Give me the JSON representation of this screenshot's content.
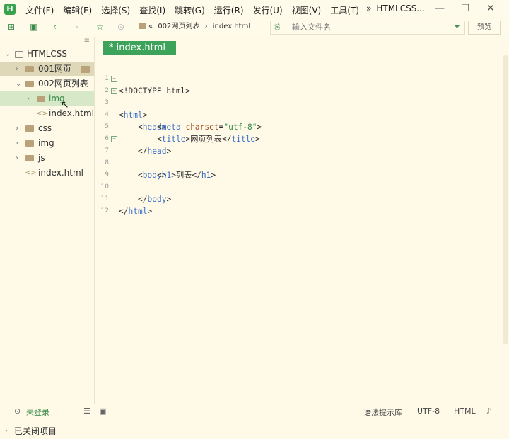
{
  "app": {
    "logo": "H",
    "menu": [
      "文件(F)",
      "编辑(E)",
      "选择(S)",
      "查找(I)",
      "跳转(G)",
      "运行(R)",
      "发行(U)",
      "视图(V)",
      "工具(T)"
    ],
    "overflow": "»",
    "window_title": "HTMLCSS...",
    "window_controls": [
      "—",
      "☐",
      "✕"
    ]
  },
  "toolbar": {
    "breadcrumb_back": "«",
    "breadcrumb_folder": "002网页列表",
    "breadcrumb_sep": "›",
    "breadcrumb_file": "index.html",
    "filter_placeholder": "输入文件名",
    "preview_label": "预览"
  },
  "sidebar": {
    "collapse_icon": "≡",
    "items": [
      {
        "label": "HTMLCSS",
        "type": "project"
      },
      {
        "label": "001网页",
        "type": "folder"
      },
      {
        "label": "002网页列表",
        "type": "folder"
      },
      {
        "label": "img",
        "type": "folder"
      },
      {
        "label": "index.html",
        "type": "file"
      },
      {
        "label": "css",
        "type": "folder"
      },
      {
        "label": "img",
        "type": "folder"
      },
      {
        "label": "js",
        "type": "folder"
      },
      {
        "label": "index.html",
        "type": "file"
      }
    ],
    "closed_projects": "已关闭项目"
  },
  "editor": {
    "tab_label": "* index.html",
    "line_numbers": [
      "1",
      "2",
      "3",
      "4",
      "5",
      "6",
      "7",
      "8",
      "9",
      "10",
      "11",
      "12"
    ],
    "code": {
      "l1": "<!DOCTYPE html>",
      "l2_open": "<",
      "l2_tag": "html",
      "l2_close": ">",
      "l3_open": "<",
      "l3_tag": "head",
      "l3_close": ">",
      "l4_open": "<",
      "l4_tag": "meta",
      "l4_attr": "charset",
      "l4_eq": "=",
      "l4_val": "\"utf-8\"",
      "l4_close": ">",
      "l5_open": "<",
      "l5_tag": "title",
      "l5_gt": ">",
      "l5_text": "网页列表",
      "l5_end_open": "</",
      "l5_end_tag": "title",
      "l5_end_close": ">",
      "l6_open": "</",
      "l6_tag": "head",
      "l6_close": ">",
      "l7_open": "<",
      "l7_tag": "body",
      "l7_close": ">",
      "l8_open": "<",
      "l8_tag": "h1",
      "l8_gt": ">",
      "l8_text": "列表",
      "l8_end_open": "</",
      "l8_end_tag": "h1",
      "l8_end_close": ">",
      "l10_open": "</",
      "l10_tag": "body",
      "l10_close": ">",
      "l11_open": "</",
      "l11_tag": "html",
      "l11_close": ">"
    }
  },
  "status": {
    "login": "未登录",
    "syntax_lib": "语法提示库",
    "encoding": "UTF-8",
    "language": "HTML"
  },
  "colors": {
    "accent": "#3ea35a",
    "background": "#fffae8",
    "tag": "#3a6ec8",
    "attribute": "#a05020",
    "string": "#3a8a4a"
  }
}
